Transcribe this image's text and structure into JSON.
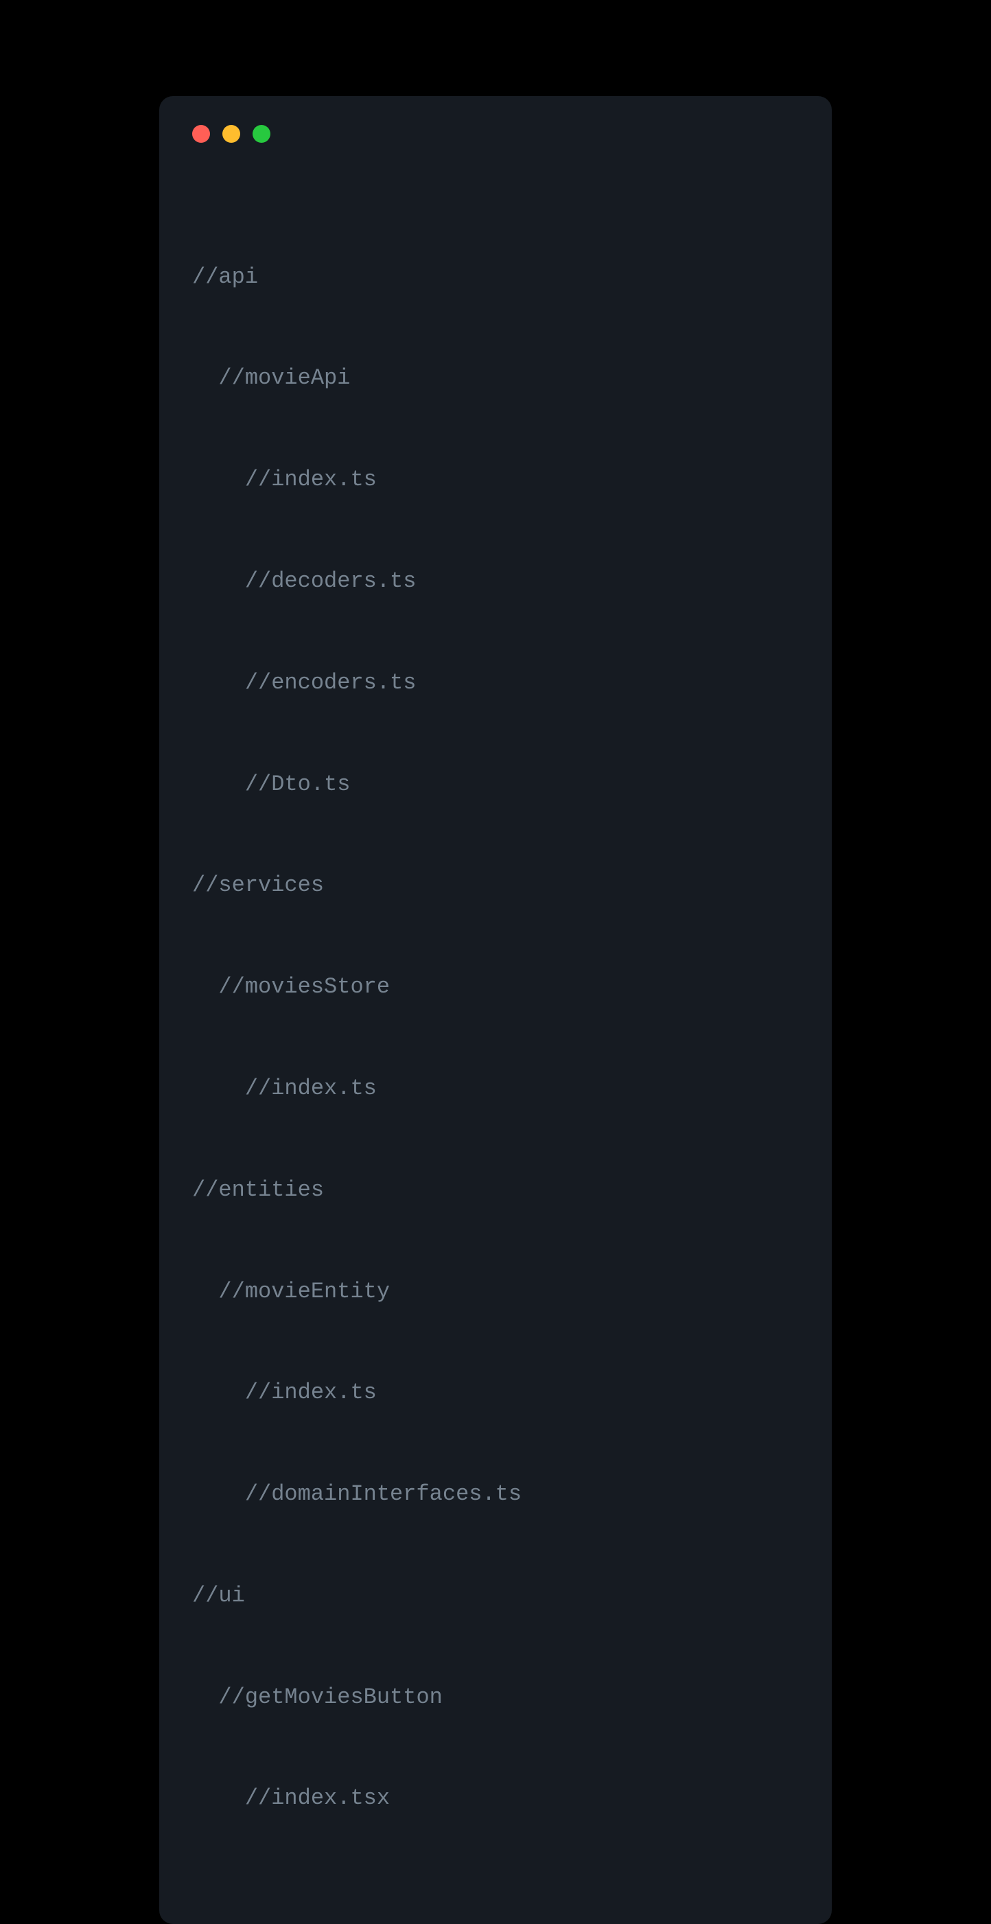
{
  "window": {
    "traffic_lights": {
      "close": "close",
      "minimize": "minimize",
      "maximize": "maximize"
    }
  },
  "code": {
    "lines": [
      "//api",
      "  //movieApi",
      "    //index.ts",
      "    //decoders.ts",
      "    //encoders.ts",
      "    //Dto.ts",
      "//services",
      "  //moviesStore",
      "    //index.ts",
      "//entities",
      "  //movieEntity",
      "    //index.ts",
      "    //domainInterfaces.ts",
      "//ui",
      "  //getMoviesButton",
      "    //index.tsx"
    ]
  },
  "colors": {
    "background": "#000000",
    "window_bg": "#161b22",
    "comment_text": "#768390",
    "close_btn": "#ff5f56",
    "minimize_btn": "#ffbd2e",
    "maximize_btn": "#27c93f"
  }
}
